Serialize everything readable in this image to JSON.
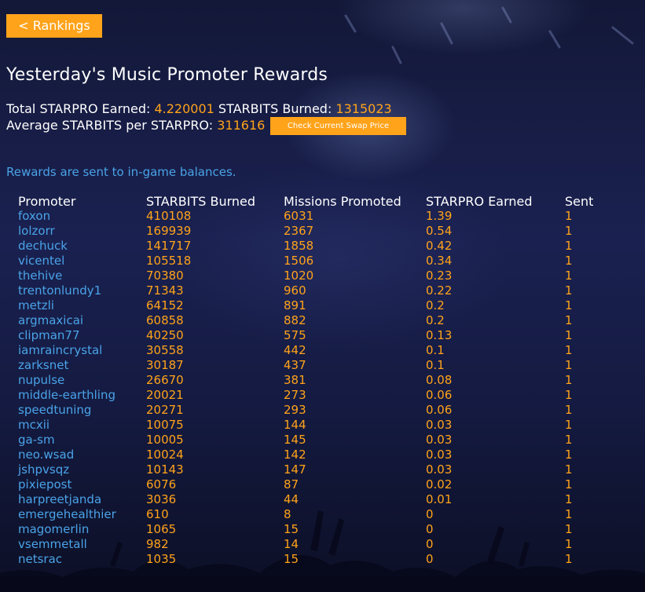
{
  "nav": {
    "back_label": "< Rankings"
  },
  "title": "Yesterday's Music Promoter Rewards",
  "summary": {
    "total_label": "Total STARPRO Earned:",
    "total_value": "4.220001",
    "burned_label": "STARBITS Burned:",
    "burned_value": "1315023",
    "average_label": "Average STARBITS per STARPRO:",
    "average_value": "311616",
    "swap_button_label": "Check Current Swap Price"
  },
  "note": "Rewards are sent to in-game balances.",
  "colors": {
    "accent": "#ffa31a",
    "link": "#4aa3e8",
    "text": "#ffffff"
  },
  "table": {
    "headers": [
      "Promoter",
      "STARBITS Burned",
      "Missions Promoted",
      "STARPRO Earned",
      "Sent"
    ],
    "rows": [
      [
        "foxon",
        "410108",
        "6031",
        "1.39",
        "1"
      ],
      [
        "lolzorr",
        "169939",
        "2367",
        "0.54",
        "1"
      ],
      [
        "dechuck",
        "141717",
        "1858",
        "0.42",
        "1"
      ],
      [
        "vicentel",
        "105518",
        "1506",
        "0.34",
        "1"
      ],
      [
        "thehive",
        "70380",
        "1020",
        "0.23",
        "1"
      ],
      [
        "trentonlundy1",
        "71343",
        "960",
        "0.22",
        "1"
      ],
      [
        "metzli",
        "64152",
        "891",
        "0.2",
        "1"
      ],
      [
        "argmaxicai",
        "60858",
        "882",
        "0.2",
        "1"
      ],
      [
        "clipman77",
        "40250",
        "575",
        "0.13",
        "1"
      ],
      [
        "iamraincrystal",
        "30558",
        "442",
        "0.1",
        "1"
      ],
      [
        "zarksnet",
        "30187",
        "437",
        "0.1",
        "1"
      ],
      [
        "nupulse",
        "26670",
        "381",
        "0.08",
        "1"
      ],
      [
        "middle-earthling",
        "20021",
        "273",
        "0.06",
        "1"
      ],
      [
        "speedtuning",
        "20271",
        "293",
        "0.06",
        "1"
      ],
      [
        "mcxii",
        "10075",
        "144",
        "0.03",
        "1"
      ],
      [
        "ga-sm",
        "10005",
        "145",
        "0.03",
        "1"
      ],
      [
        "neo.wsad",
        "10024",
        "142",
        "0.03",
        "1"
      ],
      [
        "jshpvsqz",
        "10143",
        "147",
        "0.03",
        "1"
      ],
      [
        "pixiepost",
        "6076",
        "87",
        "0.02",
        "1"
      ],
      [
        "harpreetjanda",
        "3036",
        "44",
        "0.01",
        "1"
      ],
      [
        "emergehealthier",
        "610",
        "8",
        "0",
        "1"
      ],
      [
        "magomerlin",
        "1065",
        "15",
        "0",
        "1"
      ],
      [
        "vsemmetall",
        "982",
        "14",
        "0",
        "1"
      ],
      [
        "netsrac",
        "1035",
        "15",
        "0",
        "1"
      ]
    ]
  }
}
